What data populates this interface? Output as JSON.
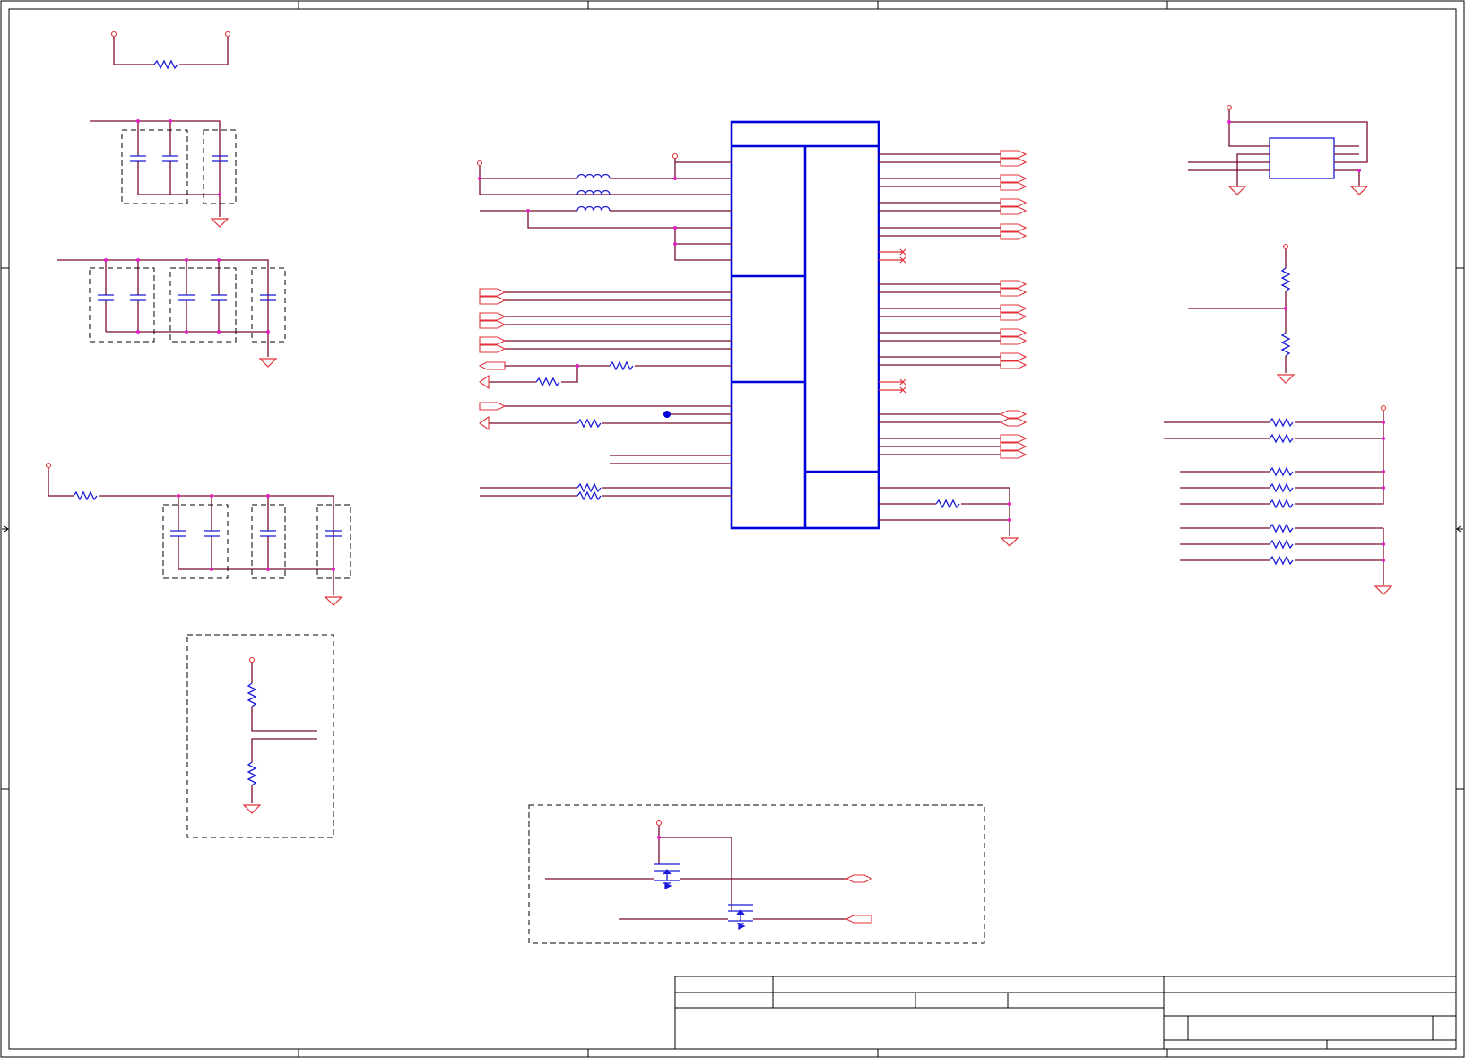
{
  "colors": {
    "wire": "#7a0a2a",
    "net_port": "#e0303a",
    "component": "#1a1ad8",
    "ic_body": "#0000dd",
    "junction": "#e020c0",
    "border": "#000000",
    "background": "#ffffff"
  },
  "icons": {
    "resistor": "resistor-icon",
    "capacitor": "capacitor-icon",
    "inductor": "inductor-icon",
    "ground": "ground-icon",
    "power_pin": "power-pin-icon",
    "transistor": "mosfet-icon",
    "no_connect": "no-connect-icon"
  }
}
